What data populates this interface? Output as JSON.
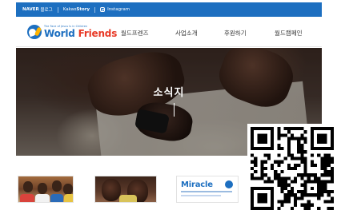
{
  "topbar": {
    "sns": [
      {
        "brand": "NAVER",
        "label": "블로그"
      },
      {
        "brand": "Kakao",
        "label": "Story"
      },
      {
        "brand": "",
        "label": "Instagram"
      }
    ]
  },
  "header": {
    "logo": {
      "tagline": "The Face of Jesus Is in Children",
      "name_part1": "World ",
      "name_part2": "Friends"
    },
    "nav": [
      {
        "label": "월드프렌즈"
      },
      {
        "label": "사업소개"
      },
      {
        "label": "후원하기"
      },
      {
        "label": "월드캠페인"
      }
    ]
  },
  "hero": {
    "title": "소식지"
  },
  "thumbnails": [
    {
      "alt": "children-photo"
    },
    {
      "alt": "two-children-photo"
    },
    {
      "title": "Miracle"
    }
  ],
  "colors": {
    "brand_blue": "#1d6fc0",
    "accent_red": "#e83a27"
  }
}
